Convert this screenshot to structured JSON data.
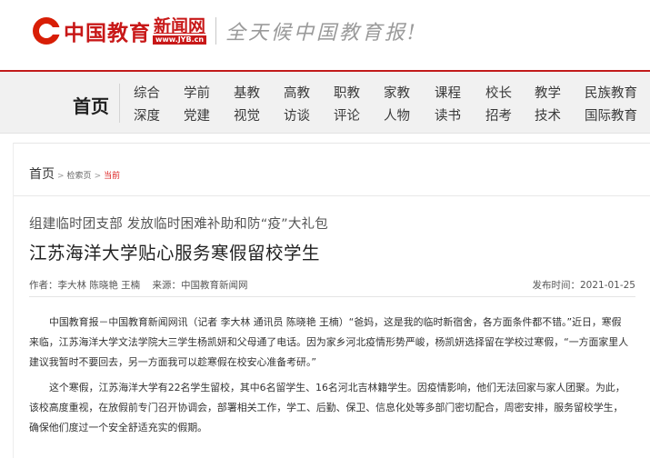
{
  "header": {
    "logo_cn": "中国教育",
    "logo_net": "新闻网",
    "logo_url": "www.JYB.cn",
    "slogan": "全天候中国教育报!"
  },
  "nav": {
    "home": "首页",
    "row1": [
      "综合",
      "学前",
      "基教",
      "高教",
      "职教",
      "家教",
      "课程",
      "校长",
      "教学",
      "民族教育"
    ],
    "row2": [
      "深度",
      "党建",
      "视觉",
      "访谈",
      "评论",
      "人物",
      "读书",
      "招考",
      "技术",
      "国际教育"
    ]
  },
  "breadcrumb": {
    "home": "首页",
    "arrow": ">",
    "section": "检索页",
    "current": "当前"
  },
  "article": {
    "subtitle": "组建临时团支部 发放临时困难补助和防“疫”大礼包",
    "title": "江苏海洋大学贴心服务寒假留校学生",
    "author": "作者：李大林 陈晓艳 王楠",
    "source": "来源：中国教育新闻网",
    "date": "发布时间：2021-01-25",
    "paragraphs": [
      "中国教育报－中国教育新闻网讯（记者 李大林 通讯员 陈晓艳 王楠）“爸妈，这是我的临时新宿舍，各方面条件都不错。”近日，寒假来临，江苏海洋大学文法学院大三学生杨凯妍和父母通了电话。因为家乡河北疫情形势严峻，杨凯妍选择留在学校过寒假，“一方面家里人建议我暂时不要回去，另一方面我可以趁寒假在校安心准备考研。”",
      "这个寒假，江苏海洋大学有22名学生留校，其中6名留学生、16名河北吉林籍学生。因疫情影响，他们无法回家与家人团聚。为此，该校高度重视，在放假前专门召开协调会，部署相关工作，学工、后勤、保卫、信息化处等多部门密切配合，周密安排，服务留校学生，确保他们度过一个安全舒适充实的假期。"
    ]
  },
  "colors": {
    "brand_red": "#c81818",
    "nav_bg": "#f1f1f1",
    "breadcrumb_current": "#dd2222"
  }
}
